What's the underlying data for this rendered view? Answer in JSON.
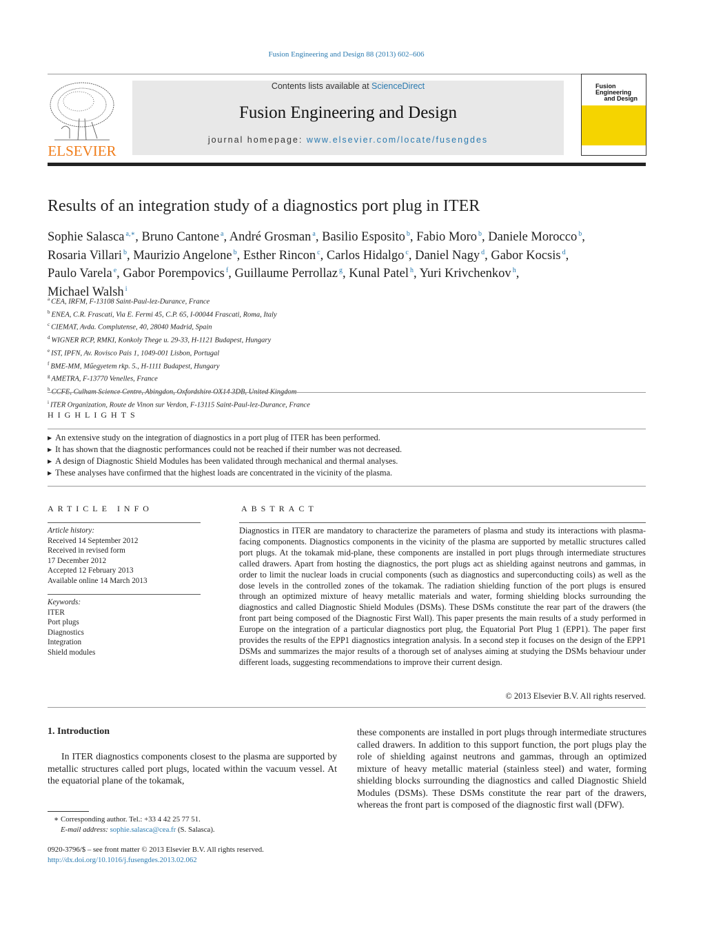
{
  "citation": "Fusion Engineering and Design 88 (2013) 602–606",
  "header": {
    "contents_prefix": "Contents lists available at ",
    "contents_link": "ScienceDirect",
    "journal": "Fusion Engineering and Design",
    "homepage_prefix": "journal homepage: ",
    "homepage_link": "www.elsevier.com/locate/fusengdes",
    "publisher": "ELSEVIER",
    "cover_title": "Fusion Engineering and Design",
    "cover_color": "#f5d400"
  },
  "title": "Results of an integration study of a diagnostics port plug in ITER",
  "authors": [
    {
      "name": "Sophie Salasca",
      "aff": "a,∗"
    },
    {
      "name": "Bruno Cantone",
      "aff": "a"
    },
    {
      "name": "André Grosman",
      "aff": "a"
    },
    {
      "name": "Basilio Esposito",
      "aff": "b"
    },
    {
      "name": "Fabio Moro",
      "aff": "b"
    },
    {
      "name": "Daniele Morocco",
      "aff": "b"
    },
    {
      "name": "Rosaria Villari",
      "aff": "b"
    },
    {
      "name": "Maurizio Angelone",
      "aff": "b"
    },
    {
      "name": "Esther Rincon",
      "aff": "c"
    },
    {
      "name": "Carlos Hidalgo",
      "aff": "c"
    },
    {
      "name": "Daniel Nagy",
      "aff": "d"
    },
    {
      "name": "Gabor Kocsis",
      "aff": "d"
    },
    {
      "name": "Paulo Varela",
      "aff": "e"
    },
    {
      "name": "Gabor Porempovics",
      "aff": "f"
    },
    {
      "name": "Guillaume Perrollaz",
      "aff": "g"
    },
    {
      "name": "Kunal Patel",
      "aff": "h"
    },
    {
      "name": "Yuri Krivchenkov",
      "aff": "h"
    },
    {
      "name": "Michael Walsh",
      "aff": "i"
    }
  ],
  "affiliations": [
    {
      "key": "a",
      "text": "CEA, IRFM, F-13108 Saint-Paul-lez-Durance, France"
    },
    {
      "key": "b",
      "text": "ENEA, C.R. Frascati, Via E. Fermi 45, C.P. 65, I-00044 Frascati, Roma, Italy"
    },
    {
      "key": "c",
      "text": "CIEMAT, Avda. Complutense, 40, 28040 Madrid, Spain"
    },
    {
      "key": "d",
      "text": "WIGNER RCP, RMKI, Konkoly Thege u. 29-33, H-1121 Budapest, Hungary"
    },
    {
      "key": "e",
      "text": "IST, IPFN, Av. Rovisco Pais 1, 1049-001 Lisbon, Portugal"
    },
    {
      "key": "f",
      "text": "BME-MM, Műegyetem rkp. 5., H-1111 Budapest, Hungary"
    },
    {
      "key": "g",
      "text": "AMETRA, F-13770 Venelles, France"
    },
    {
      "key": "h",
      "text": "CCFE, Culham Science Centre, Abingdon, Oxfordshire OX14 3DB, United Kingdom"
    },
    {
      "key": "i",
      "text": "ITER Organization, Route de Vinon sur Verdon, F-13115 Saint-Paul-lez-Durance, France"
    }
  ],
  "highlights": {
    "heading": "HIGHLIGHTS",
    "items": [
      "An extensive study on the integration of diagnostics in a port plug of ITER has been performed.",
      "It has shown that the diagnostic performances could not be reached if their number was not decreased.",
      "A design of Diagnostic Shield Modules has been validated through mechanical and thermal analyses.",
      "These analyses have confirmed that the highest loads are concentrated in the vicinity of the plasma."
    ]
  },
  "article_info": {
    "heading": "ARTICLE INFO",
    "history_label": "Article history:",
    "history": [
      "Received 14 September 2012",
      "Received in revised form",
      "17 December 2012",
      "Accepted 12 February 2013",
      "Available online 14 March 2013"
    ],
    "keywords_label": "Keywords:",
    "keywords": [
      "ITER",
      "Port plugs",
      "Diagnostics",
      "Integration",
      "Shield modules"
    ]
  },
  "abstract": {
    "heading": "ABSTRACT",
    "text": "Diagnostics in ITER are mandatory to characterize the parameters of plasma and study its interactions with plasma-facing components. Diagnostics components in the vicinity of the plasma are supported by metallic structures called port plugs. At the tokamak mid-plane, these components are installed in port plugs through intermediate structures called drawers. Apart from hosting the diagnostics, the port plugs act as shielding against neutrons and gammas, in order to limit the nuclear loads in crucial components (such as diagnostics and superconducting coils) as well as the dose levels in the controlled zones of the tokamak. The radiation shielding function of the port plugs is ensured through an optimized mixture of heavy metallic materials and water, forming shielding blocks surrounding the diagnostics and called Diagnostic Shield Modules (DSMs). These DSMs constitute the rear part of the drawers (the front part being composed of the Diagnostic First Wall). This paper presents the main results of a study performed in Europe on the integration of a particular diagnostics port plug, the Equatorial Port Plug 1 (EPP1). The paper first provides the results of the EPP1 diagnostics integration analysis. In a second step it focuses on the design of the EPP1 DSMs and summarizes the major results of a thorough set of analyses aiming at studying the DSMs behaviour under different loads, suggesting recommendations to improve their current design.",
    "copyright": "© 2013 Elsevier B.V. All rights reserved."
  },
  "intro": {
    "heading": "1.  Introduction",
    "left": "In ITER diagnostics components closest to the plasma are supported by metallic structures called port plugs, located within the vacuum vessel. At the equatorial plane of the tokamak,",
    "right": "these components are installed in port plugs through intermediate structures called drawers. In addition to this support function, the port plugs play the role of shielding against neutrons and gammas, through an optimized mixture of heavy metallic material (stainless steel) and water, forming shielding blocks surrounding the diagnostics and called Diagnostic Shield Modules (DSMs). These DSMs constitute the rear part of the drawers, whereas the front part is composed of the diagnostic first wall (DFW)."
  },
  "footnote": {
    "corresponding": "∗  Corresponding author. Tel.: +33 4 42 25 77 51.",
    "email_label": "E-mail address: ",
    "email": "sophie.salasca@cea.fr",
    "email_suffix": " (S. Salasca)."
  },
  "front_matter": "0920-3796/$ – see front matter © 2013 Elsevier B.V. All rights reserved.",
  "doi": "http://dx.doi.org/10.1016/j.fusengdes.2013.02.062"
}
